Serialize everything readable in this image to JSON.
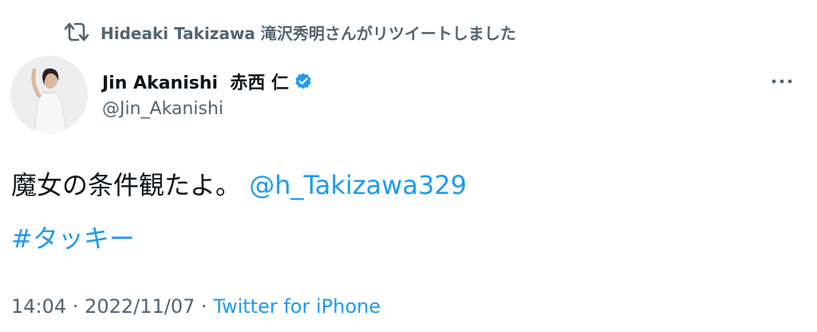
{
  "retweet": {
    "icon": "retweet-icon",
    "text": "Hideaki Takizawa 滝沢秀明さんがリツイートしました"
  },
  "author": {
    "avatar": "avatar-photo",
    "name": "Jin Akanishi  赤西 仁",
    "verified_icon": "verified-badge-icon",
    "handle": "@Jin_Akanishi"
  },
  "menu": {
    "icon": "more-options-icon"
  },
  "tweet": {
    "text": "魔女の条件観たよ。",
    "mention": "@h_Takizawa329",
    "hashtag": "#タッキー"
  },
  "meta": {
    "time": "14:04",
    "separator1": " · ",
    "date": "2022/11/07",
    "separator2": " · ",
    "source": "Twitter for iPhone"
  },
  "colors": {
    "accent": "#1d9bf0",
    "secondary_text": "#536471",
    "primary_text": "#0f1419"
  }
}
